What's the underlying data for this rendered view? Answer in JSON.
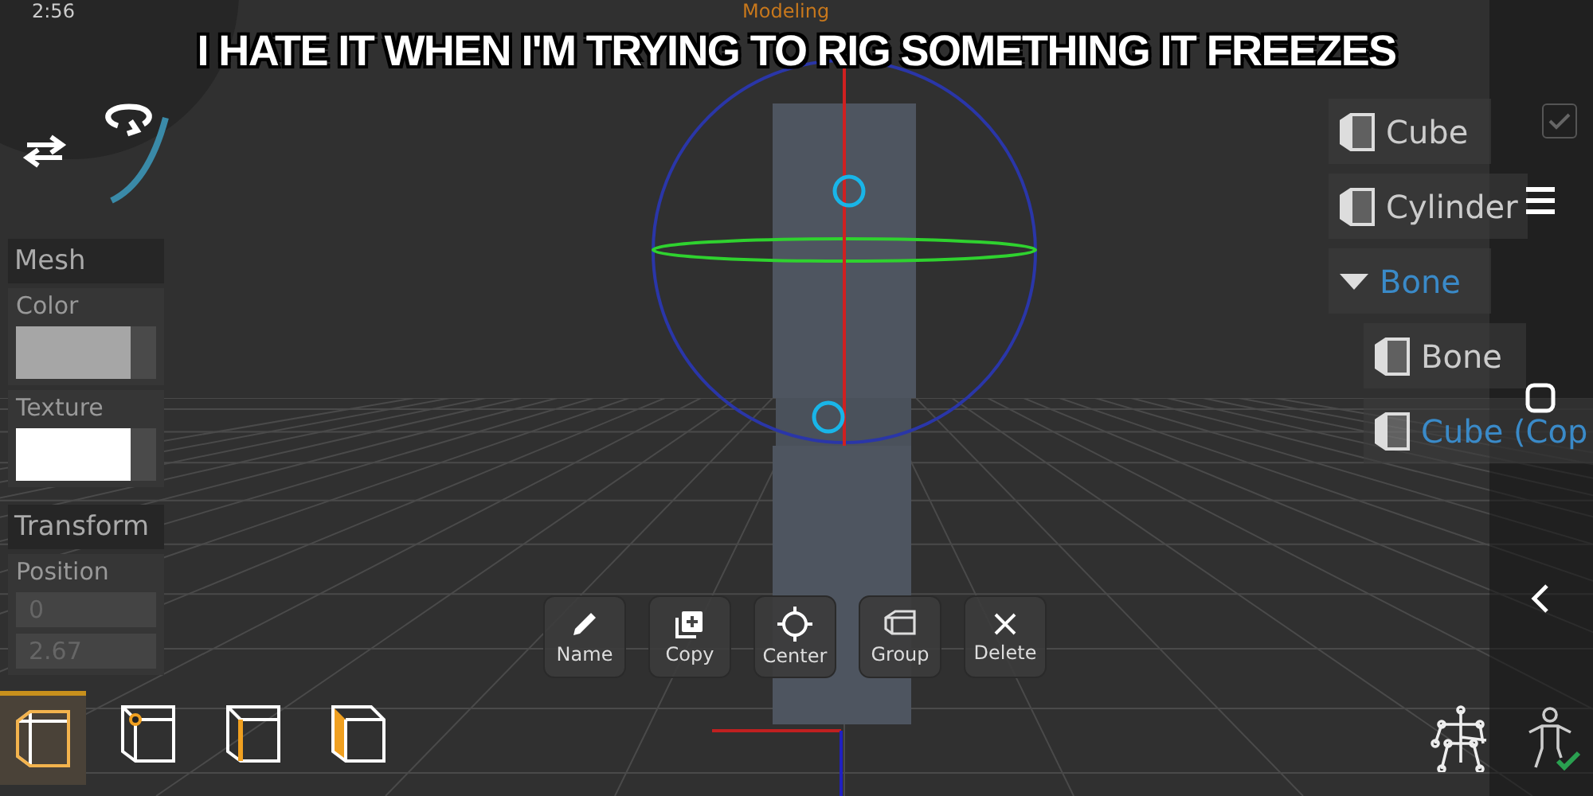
{
  "title": "Modeling",
  "status_time": "2:56",
  "caption": "I HATE IT WHEN I'M TRYING TO RIG SOMETHING IT FREEZES",
  "properties": {
    "mesh": {
      "title": "Mesh",
      "color_label": "Color",
      "texture_label": "Texture"
    },
    "transform": {
      "title": "Transform",
      "position_label": "Position",
      "position_values": [
        "0",
        "2.67"
      ]
    }
  },
  "outline": [
    {
      "label": "Cube",
      "kind": "mesh",
      "selected": false
    },
    {
      "label": "Cylinder",
      "kind": "mesh",
      "selected": false
    },
    {
      "label": "Bone",
      "kind": "group",
      "expanded": true,
      "selected": true,
      "children": [
        {
          "label": "Bone",
          "kind": "mesh",
          "selected": false
        },
        {
          "label": "Cube (Cop",
          "kind": "mesh",
          "selected": true
        }
      ]
    }
  ],
  "visible_checkbox": {
    "checked": true
  },
  "actions": [
    {
      "label": "Name",
      "kind": "pencil"
    },
    {
      "label": "Copy",
      "kind": "copy"
    },
    {
      "label": "Center",
      "kind": "crosshair"
    },
    {
      "label": "Group",
      "kind": "box"
    },
    {
      "label": "Delete",
      "kind": "close"
    }
  ],
  "select_modes": [
    {
      "kind": "object",
      "selected": true
    },
    {
      "kind": "vertex",
      "selected": false
    },
    {
      "kind": "edge",
      "selected": false
    },
    {
      "kind": "face",
      "selected": false
    }
  ]
}
